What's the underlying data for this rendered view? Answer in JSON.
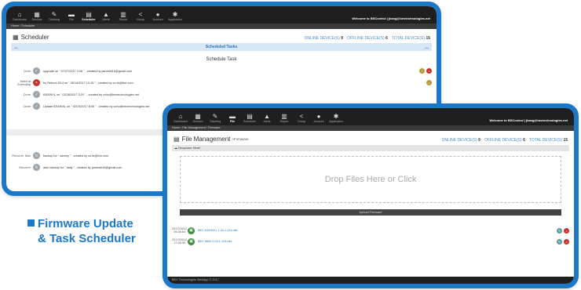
{
  "nav_items": [
    {
      "icon": "⌂",
      "label": "Dashboard"
    },
    {
      "icon": "▦",
      "label": "Devices"
    },
    {
      "icon": "✎",
      "label": "Ticketing"
    },
    {
      "icon": "▬",
      "label": "File"
    },
    {
      "icon": "▤",
      "label": "Scheduler"
    },
    {
      "icon": "▲",
      "label": "Alerts"
    },
    {
      "icon": "▥",
      "label": "Report"
    },
    {
      "icon": "<",
      "label": "Group"
    },
    {
      "icon": "●",
      "label": "Account"
    },
    {
      "icon": "✱",
      "label": "Application"
    }
  ],
  "scheduler": {
    "welcome": "Welcome to BSControl | jkang@bectechnologies.net",
    "breadcrumb": "Home / Scheduler",
    "title": "Scheduler",
    "counts": {
      "online": "ONLINE DEVICE(S)",
      "online_n": "9",
      "offline": "OFFLINE DEVICE(S)",
      "offline_n": "6",
      "total": "TOTAL DEVICE(S)",
      "total_n": "15"
    },
    "bar_title": "Scheduled Tasks",
    "section_title": "Schedule Task",
    "tasks": [
      {
        "status": "Done",
        "desc": "upgrade on \" 07/27/2017 2:06 \" , created by jamesbt15@gmail.com"
      },
      {
        "status": "failed at Executing",
        "desc": "try Reboot 5/14 on \" 05/14/2017 12:15 \" , created by vu.te@live.com"
      },
      {
        "status": "Done",
        "desc": "6300NXL on \" 02/26/2017 3:20 \" , created by vchu@bectechnologies.net"
      },
      {
        "status": "Done",
        "desc": "Update 6300NXL on \" 02/23/2017 8:00 \" , created by cchu@bectechnologies.net"
      }
    ],
    "recurring": [
      {
        "status": "Recurrer Task",
        "desc": "backup for \" weekly \" , created by vu.te@live.com"
      },
      {
        "status": "Recurrer",
        "desc": "auto backup for \" daily \" , created by jamesbt15@gmail.com"
      }
    ]
  },
  "filemgmt": {
    "welcome": "Welcome to BSControl | jkang@bectechnologies.net",
    "breadcrumb": "Home / File Management / Firmware",
    "title": "File Management",
    "subtitle": ">Firmware",
    "counts": {
      "online": "ONLINE DEVICE(S)",
      "online_n": "9",
      "offline": "OFFLINE DEVICE(S)",
      "offline_n": "6",
      "total": "TOTAL DEVICE(S)",
      "total_n": "15"
    },
    "dropzone_header": "Dropzone Here!",
    "dropzone_text": "Drop Files Here or Click",
    "upload_label": "Upload Firmware",
    "files": [
      {
        "date": "2017/04/12 09:39:54",
        "name": "BEC 6300NXL 1.04.1.124.ufw"
      },
      {
        "date": "2017/04/12 17:25:39",
        "name": "BEC 6600 1.04.1.124.ufw"
      }
    ],
    "footer": "BEC Technologies WebApp © 2017"
  },
  "caption": {
    "line1": "Firmware Update",
    "line2": "& Task Scheduler"
  }
}
